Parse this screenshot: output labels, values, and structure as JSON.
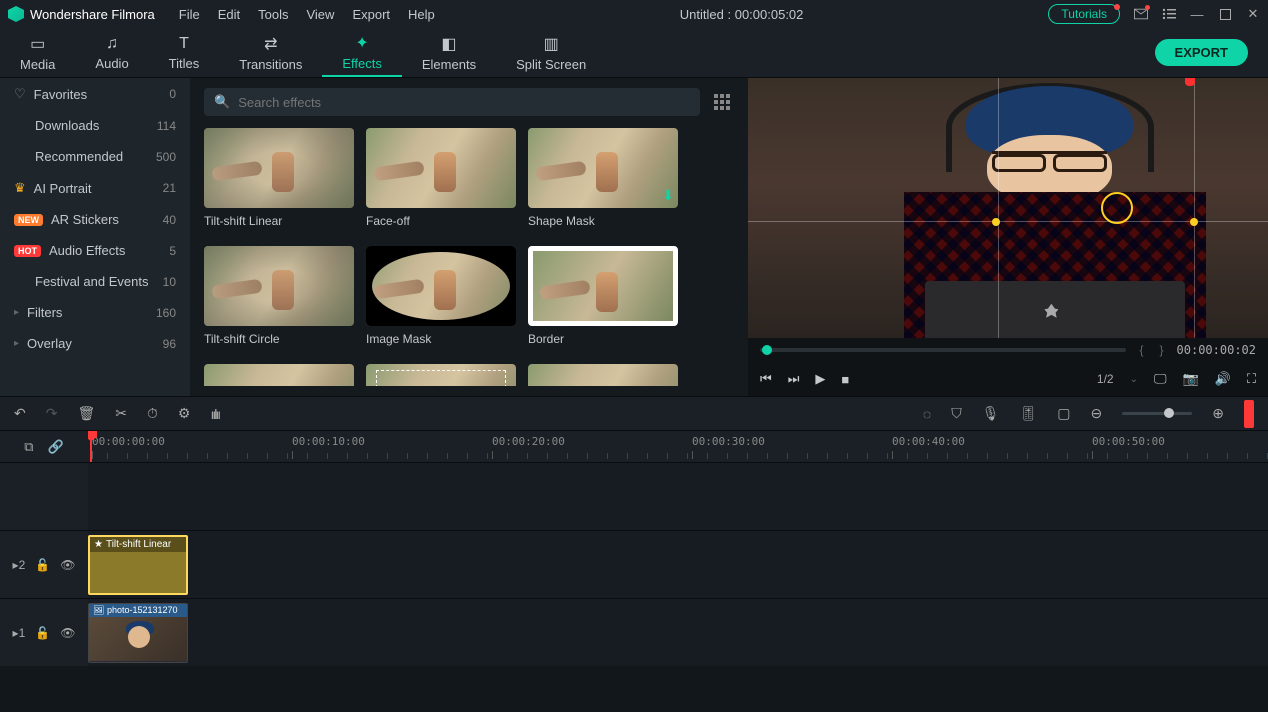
{
  "app": {
    "name": "Wondershare Filmora"
  },
  "menu": [
    "File",
    "Edit",
    "Tools",
    "View",
    "Export",
    "Help"
  ],
  "title": "Untitled : 00:00:05:02",
  "tutorials_label": "Tutorials",
  "tabs": [
    {
      "label": "Media"
    },
    {
      "label": "Audio"
    },
    {
      "label": "Titles"
    },
    {
      "label": "Transitions"
    },
    {
      "label": "Effects"
    },
    {
      "label": "Elements"
    },
    {
      "label": "Split Screen"
    }
  ],
  "active_tab": "Effects",
  "export_label": "EXPORT",
  "sidebar": [
    {
      "icon": "heart",
      "label": "Favorites",
      "count": 0
    },
    {
      "label": "Downloads",
      "count": 114
    },
    {
      "label": "Recommended",
      "count": 500
    },
    {
      "icon": "crown",
      "label": "AI Portrait",
      "count": 21
    },
    {
      "badge": "NEW",
      "label": "AR Stickers",
      "count": 40
    },
    {
      "badge": "HOT",
      "label": "Audio Effects",
      "count": 5
    },
    {
      "label": "Festival and Events",
      "count": 10
    },
    {
      "expand": true,
      "label": "Filters",
      "count": 160
    },
    {
      "expand": true,
      "label": "Overlay",
      "count": 96
    }
  ],
  "search": {
    "placeholder": "Search effects"
  },
  "effects": [
    {
      "name": "Tilt-shift Linear",
      "variant": "blur"
    },
    {
      "name": "Face-off",
      "variant": "plain"
    },
    {
      "name": "Shape Mask",
      "variant": "plain",
      "download": true
    },
    {
      "name": "Tilt-shift Circle",
      "variant": "blur"
    },
    {
      "name": "Image Mask",
      "variant": "oval"
    },
    {
      "name": "Border",
      "variant": "border"
    },
    {
      "name": "",
      "variant": "plain"
    },
    {
      "name": "",
      "variant": "mask"
    },
    {
      "name": "",
      "variant": "plain"
    }
  ],
  "preview": {
    "timecode": "00:00:00:02",
    "ratio": "1/2"
  },
  "ruler": [
    "00:00:00:00",
    "00:00:10:00",
    "00:00:20:00",
    "00:00:30:00",
    "00:00:40:00",
    "00:00:50:00"
  ],
  "timeline": {
    "fx_clip": "Tilt-shift Linear",
    "video_clip": "photo-152131270",
    "track2": "2",
    "track1": "1"
  }
}
